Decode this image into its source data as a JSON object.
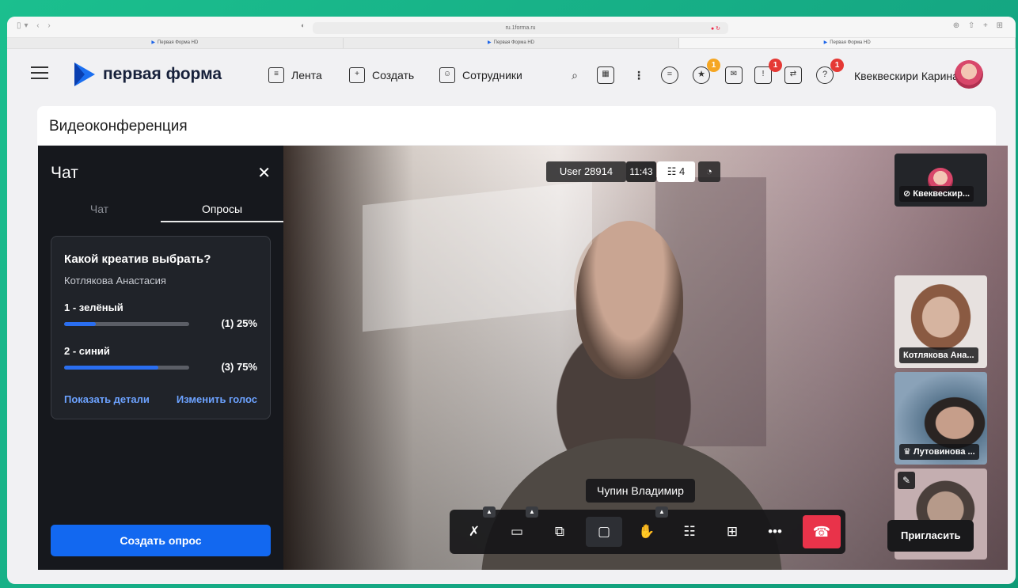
{
  "browser": {
    "url": "ru.1forma.ru",
    "tabs": [
      "Первая Форма HD",
      "Первая Форма HD",
      "Первая Форма HD"
    ]
  },
  "header": {
    "logo_text": "первая форма",
    "nav": [
      "Лента",
      "Создать",
      "Сотрудники"
    ],
    "badges": {
      "favorites": "1",
      "notifications": "1",
      "help": "1"
    },
    "user_name": "Квеквескири Карина"
  },
  "page": {
    "title": "Видеоконференция"
  },
  "chat": {
    "title": "Чат",
    "tabs": [
      "Чат",
      "Опросы"
    ],
    "active_tab": "Опросы",
    "poll": {
      "question": "Какой креатив выбрать?",
      "author": "Котлякова Анастасия",
      "options": [
        {
          "label": "1 - зелёный",
          "result": "(1) 25%",
          "fraction": 0.25
        },
        {
          "label": "2 - синий",
          "result": "(3) 75%",
          "fraction": 0.75
        }
      ],
      "show_details": "Показать детали",
      "change_vote": "Изменить голос"
    },
    "create_button": "Создать опрос"
  },
  "call": {
    "user": "User 28914",
    "time": "11:43",
    "participants_count": "4",
    "speaker_name": "Чупин Владимир",
    "participants": [
      {
        "name": "Квеквескир..."
      },
      {
        "name": "Котлякова Ана..."
      },
      {
        "name": "Лутовинова ..."
      }
    ],
    "invite_button": "Пригласить"
  },
  "colors": {
    "accent": "#1268f0",
    "hangup": "#e9334a",
    "badge_orange": "#f5a623",
    "badge_red": "#e53935"
  }
}
